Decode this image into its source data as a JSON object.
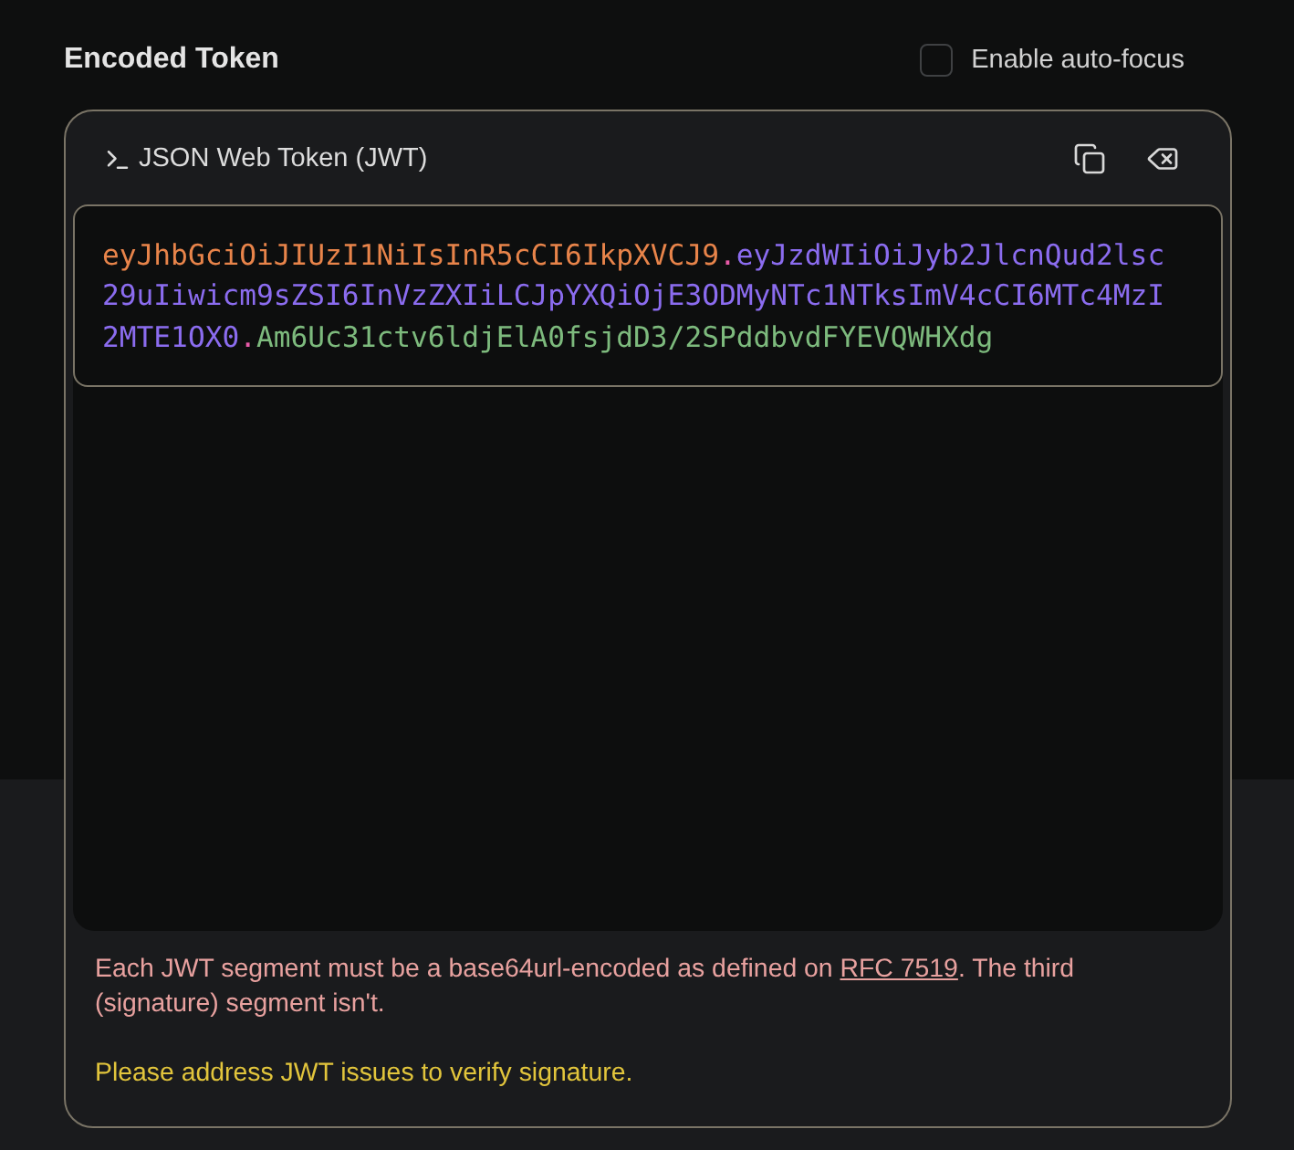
{
  "header": {
    "title": "Encoded Token",
    "auto_focus": {
      "label": "Enable auto-focus",
      "checked": false
    }
  },
  "token_panel": {
    "title": "JSON Web Token (JWT)",
    "actions": [
      {
        "kind": "copy"
      },
      {
        "kind": "clear"
      }
    ],
    "segments": [
      {
        "kind": "header",
        "text": "eyJhbGciOiJIUzI1NiIsInR5cCI6IkpXVCJ9"
      },
      {
        "kind": "separator",
        "text": "."
      },
      {
        "kind": "payload",
        "text": "eyJzdWIiOiJyb2JlcnQud2lsc29uIiwicm9sZSI6InVzZXIiLCJpYXQiOjE3ODMyNTc1NTksImV4cCI6MTc4MzI2MTE1OX0"
      },
      {
        "kind": "separator",
        "text": "."
      },
      {
        "kind": "signature",
        "text": "Am6Uc31ctv6ldjElA0fsjdD3/2SPddbvdFYEVQWHXdg"
      }
    ],
    "messages": [
      {
        "kind": "error",
        "text_before": "Each JWT segment must be a base64url-encoded as defined on ",
        "link": "RFC 7519",
        "text_after": ". The third (signature) segment isn't."
      },
      {
        "kind": "warning",
        "text": "Please address JWT issues to verify signature."
      }
    ]
  }
}
